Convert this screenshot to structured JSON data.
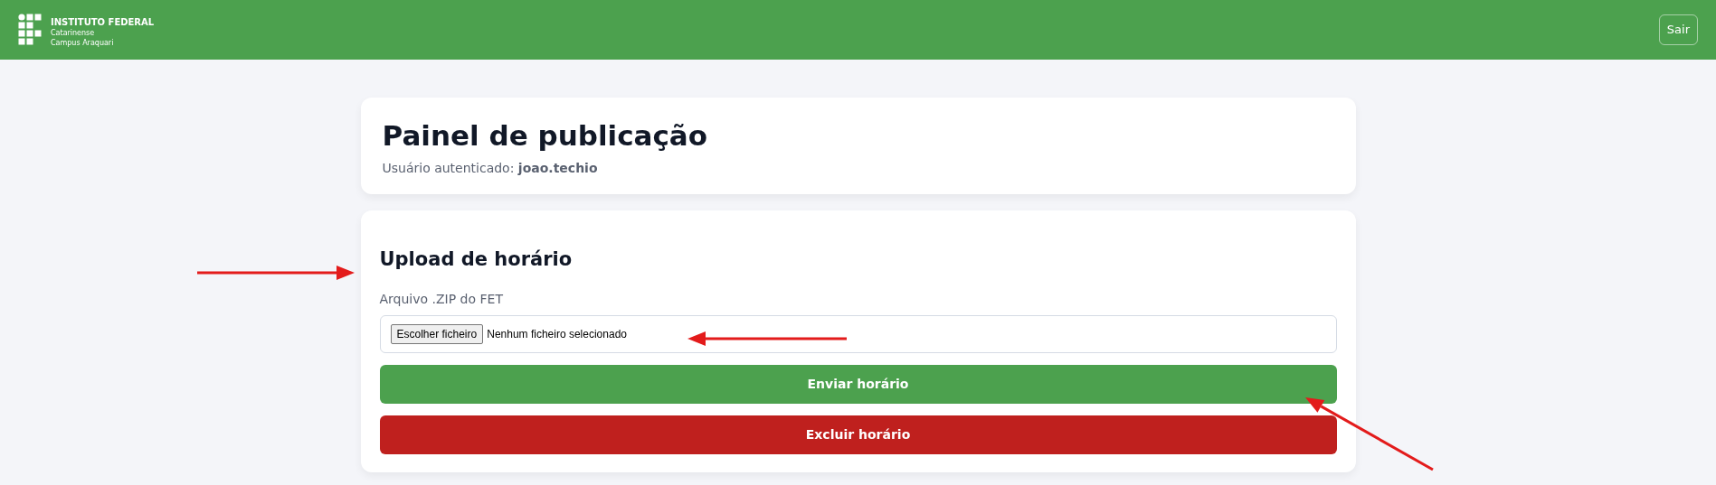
{
  "header": {
    "logo_title": "INSTITUTO FEDERAL",
    "logo_lines": [
      "Catarinense",
      "Campus Araquari"
    ],
    "logout_button": "Sair"
  },
  "panel": {
    "title": "Painel de publicação",
    "user_line": "Usuário autenticado: **joao.techio**"
  },
  "upload": {
    "title": "Upload de horário",
    "field_label": "Arquivo .ZIP do FET",
    "file_button": "Escolher ficheiro",
    "file_status": "Nenhum ficheiro selecionado",
    "actions": [
      {
        "label": "Enviar horário",
        "kind": "primary"
      },
      {
        "label": "Excluir horário",
        "kind": "danger"
      }
    ]
  }
}
